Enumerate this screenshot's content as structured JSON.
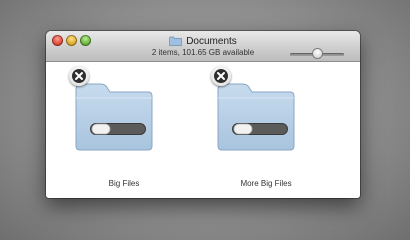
{
  "window": {
    "title": "Documents",
    "status_text": "2 items, 101.65 GB available",
    "zoom_level": 0.5
  },
  "items": [
    {
      "label": "Big Files"
    },
    {
      "label": "More Big Files"
    }
  ],
  "icons": {
    "title": "folder-icon",
    "item": "folder-icon",
    "badge": "delete-icon",
    "toggle": "switch-toggle-icon"
  },
  "colors": {
    "close": "#d8412f",
    "minimize": "#d7a321",
    "zoom": "#5fa735",
    "folder": "#b4cde4"
  }
}
